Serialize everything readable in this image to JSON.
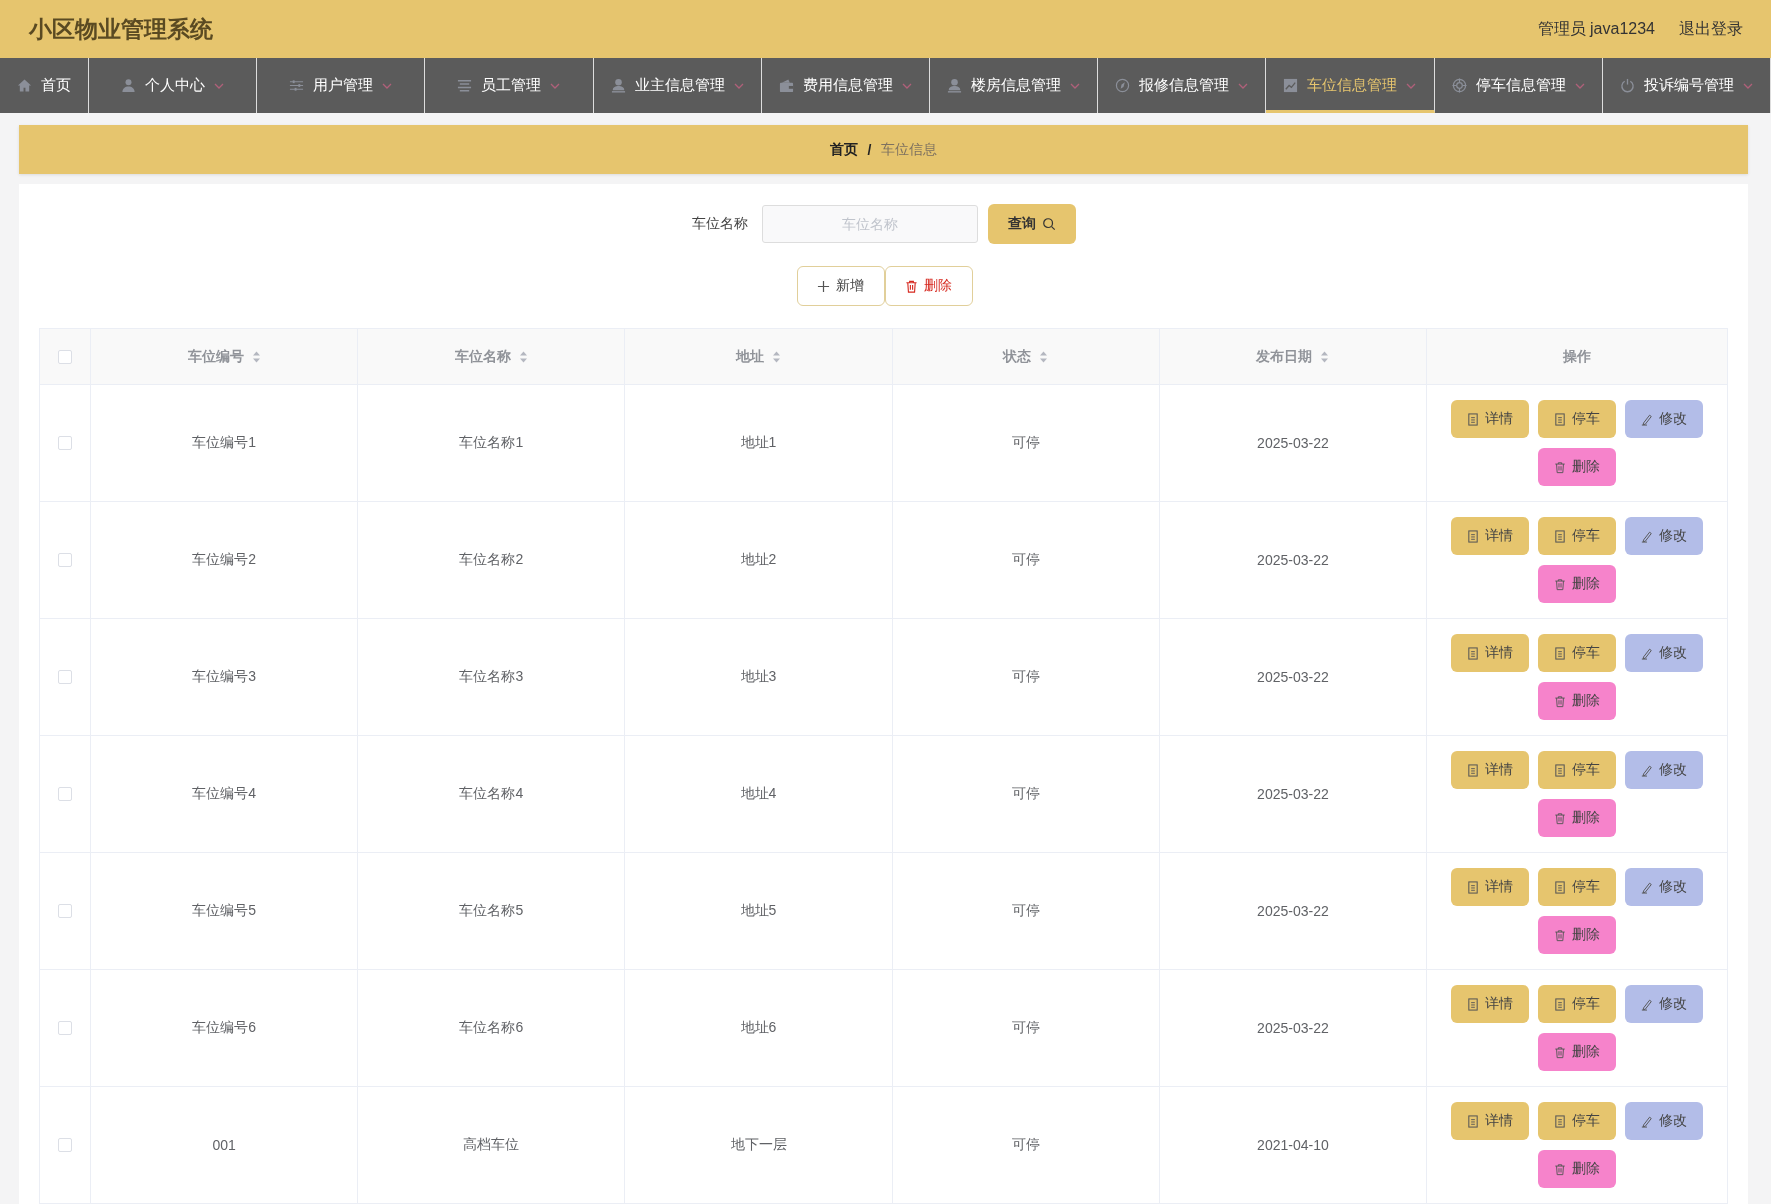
{
  "header": {
    "title": "小区物业管理系统",
    "user": "管理员 java1234",
    "logout": "退出登录"
  },
  "nav": [
    {
      "label": "首页",
      "selected": false,
      "dropdown": false
    },
    {
      "label": "个人中心",
      "selected": false,
      "dropdown": true
    },
    {
      "label": "用户管理",
      "selected": false,
      "dropdown": true
    },
    {
      "label": "员工管理",
      "selected": false,
      "dropdown": true
    },
    {
      "label": "业主信息管理",
      "selected": false,
      "dropdown": true
    },
    {
      "label": "费用信息管理",
      "selected": false,
      "dropdown": true
    },
    {
      "label": "楼房信息管理",
      "selected": false,
      "dropdown": true
    },
    {
      "label": "报修信息管理",
      "selected": false,
      "dropdown": true
    },
    {
      "label": "车位信息管理",
      "selected": true,
      "dropdown": true
    },
    {
      "label": "停车信息管理",
      "selected": false,
      "dropdown": true
    },
    {
      "label": "投诉编号管理",
      "selected": false,
      "dropdown": true
    }
  ],
  "breadcrumb": [
    {
      "label": "首页",
      "selected": false
    },
    {
      "label": "车位信息",
      "selected": true
    }
  ],
  "breadcrumb_separator": "/",
  "search": {
    "label": "车位名称",
    "placeholder": "车位名称",
    "button": "查询"
  },
  "actions": [
    {
      "kind": "add",
      "label": "新增"
    },
    {
      "kind": "delete",
      "label": "删除"
    }
  ],
  "table": {
    "columns": [
      {
        "label": "车位编号",
        "sortable": true
      },
      {
        "label": "车位名称",
        "sortable": true
      },
      {
        "label": "地址",
        "sortable": true
      },
      {
        "label": "状态",
        "sortable": true
      },
      {
        "label": "发布日期",
        "sortable": true
      },
      {
        "label": "操作",
        "sortable": false
      }
    ],
    "header_checked": false,
    "rows": [
      {
        "checked": false,
        "cells": [
          "车位编号1",
          "车位名称1",
          "地址1",
          "可停",
          "2025-03-22"
        ],
        "buttons": [
          {
            "kind": "detail",
            "label": "详情"
          },
          {
            "kind": "park",
            "label": "停车"
          },
          {
            "kind": "edit",
            "label": "修改"
          },
          {
            "kind": "delete",
            "label": "删除"
          }
        ]
      },
      {
        "checked": false,
        "cells": [
          "车位编号2",
          "车位名称2",
          "地址2",
          "可停",
          "2025-03-22"
        ],
        "buttons": [
          {
            "kind": "detail",
            "label": "详情"
          },
          {
            "kind": "park",
            "label": "停车"
          },
          {
            "kind": "edit",
            "label": "修改"
          },
          {
            "kind": "delete",
            "label": "删除"
          }
        ]
      },
      {
        "checked": false,
        "cells": [
          "车位编号3",
          "车位名称3",
          "地址3",
          "可停",
          "2025-03-22"
        ],
        "buttons": [
          {
            "kind": "detail",
            "label": "详情"
          },
          {
            "kind": "park",
            "label": "停车"
          },
          {
            "kind": "edit",
            "label": "修改"
          },
          {
            "kind": "delete",
            "label": "删除"
          }
        ]
      },
      {
        "checked": false,
        "cells": [
          "车位编号4",
          "车位名称4",
          "地址4",
          "可停",
          "2025-03-22"
        ],
        "buttons": [
          {
            "kind": "detail",
            "label": "详情"
          },
          {
            "kind": "park",
            "label": "停车"
          },
          {
            "kind": "edit",
            "label": "修改"
          },
          {
            "kind": "delete",
            "label": "删除"
          }
        ]
      },
      {
        "checked": false,
        "cells": [
          "车位编号5",
          "车位名称5",
          "地址5",
          "可停",
          "2025-03-22"
        ],
        "buttons": [
          {
            "kind": "detail",
            "label": "详情"
          },
          {
            "kind": "park",
            "label": "停车"
          },
          {
            "kind": "edit",
            "label": "修改"
          },
          {
            "kind": "delete",
            "label": "删除"
          }
        ]
      },
      {
        "checked": false,
        "cells": [
          "车位编号6",
          "车位名称6",
          "地址6",
          "可停",
          "2025-03-22"
        ],
        "buttons": [
          {
            "kind": "detail",
            "label": "详情"
          },
          {
            "kind": "park",
            "label": "停车"
          },
          {
            "kind": "edit",
            "label": "修改"
          },
          {
            "kind": "delete",
            "label": "删除"
          }
        ]
      },
      {
        "checked": false,
        "cells": [
          "001",
          "高档车位",
          "地下一层",
          "可停",
          "2021-04-10"
        ],
        "buttons": [
          {
            "kind": "detail",
            "label": "详情"
          },
          {
            "kind": "park",
            "label": "停车"
          },
          {
            "kind": "edit",
            "label": "修改"
          },
          {
            "kind": "delete",
            "label": "删除"
          }
        ]
      }
    ]
  }
}
